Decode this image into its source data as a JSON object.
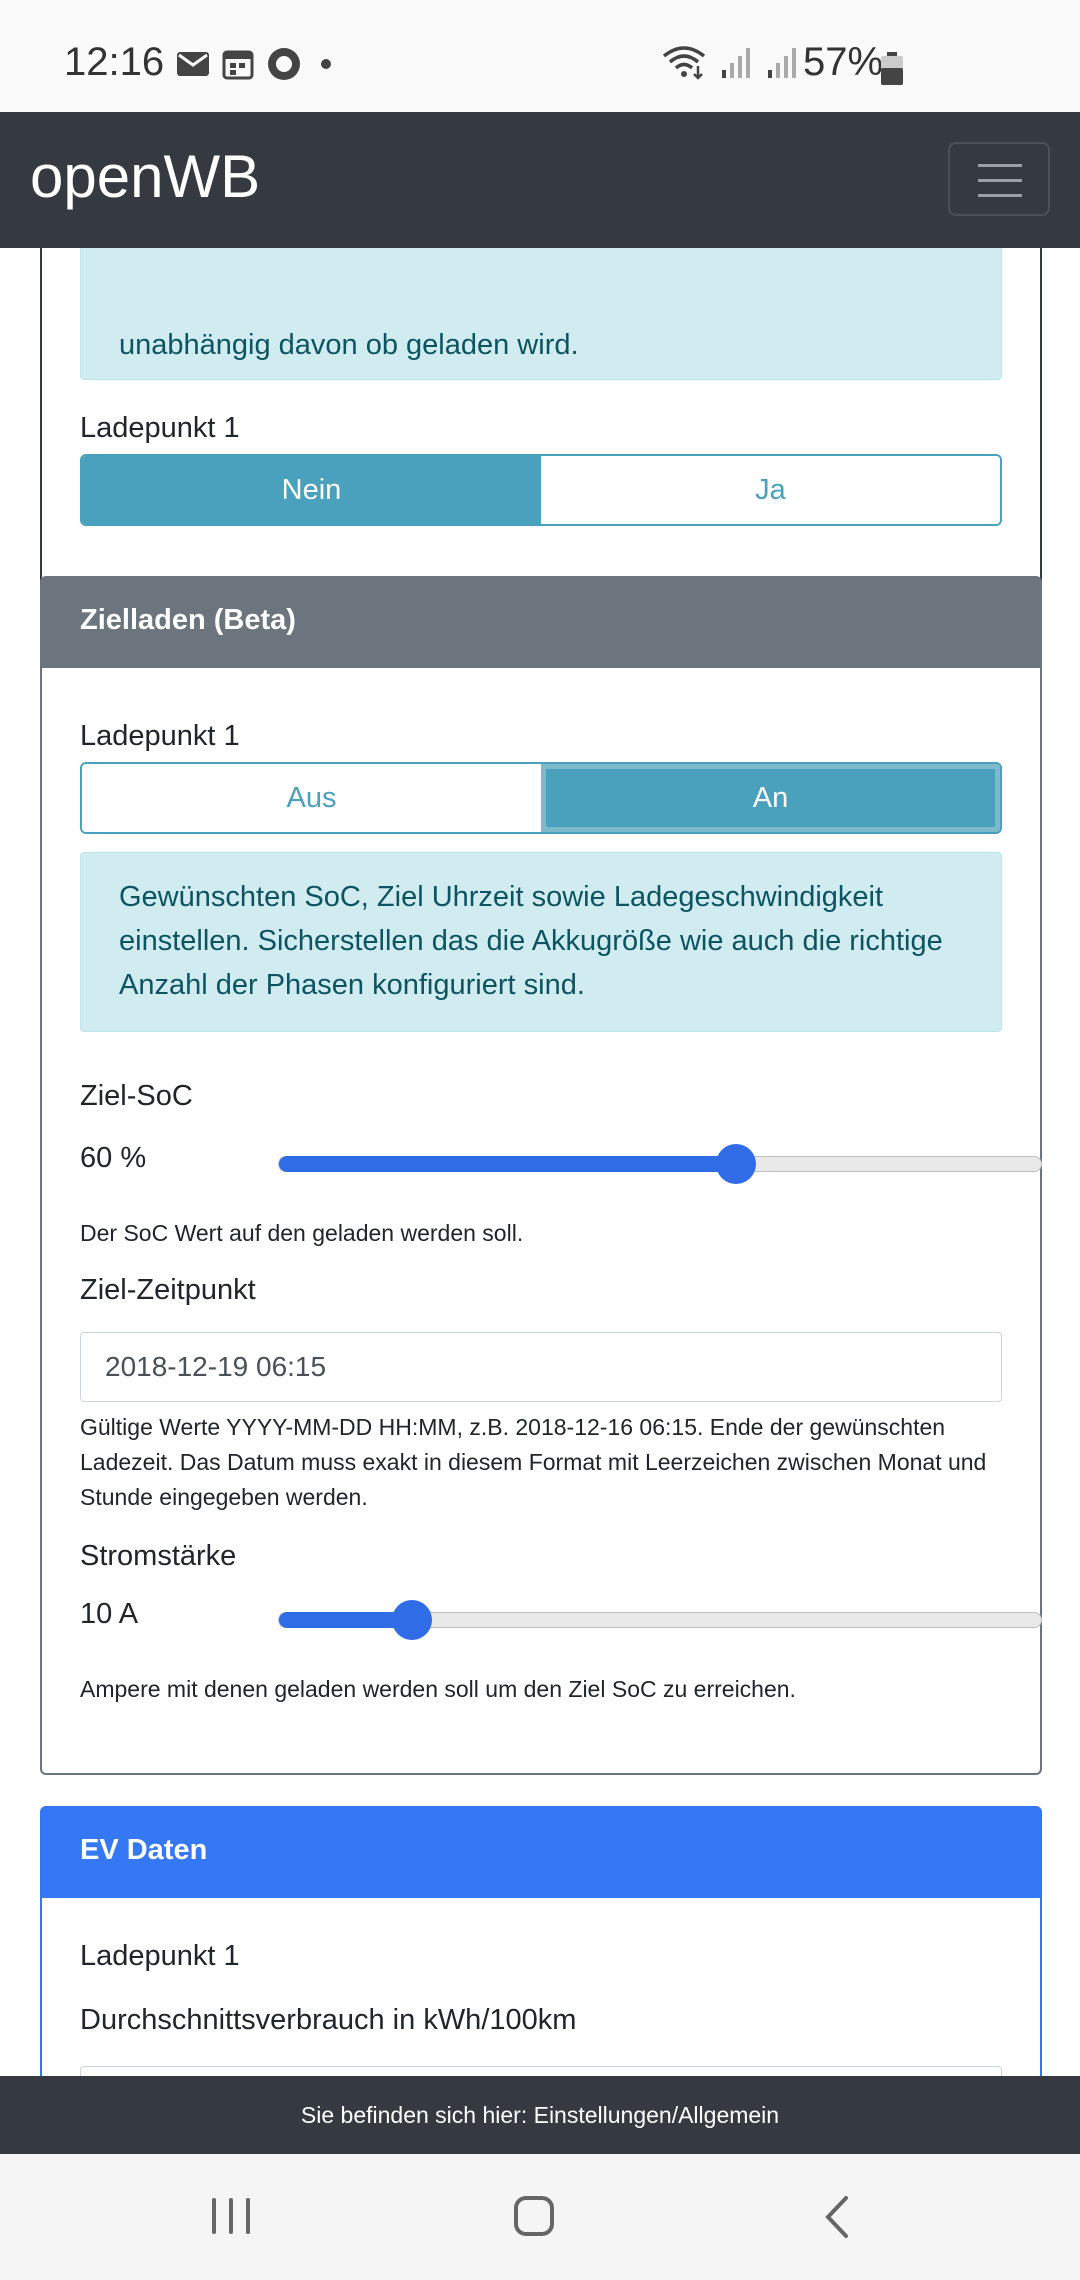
{
  "status_bar": {
    "time": "12:16",
    "battery": "57%",
    "icons": [
      "mail-icon",
      "calendar-icon",
      "record-icon",
      "dot-icon",
      "wifi-icon",
      "signal-icon",
      "signal-icon",
      "battery-icon"
    ]
  },
  "navbar": {
    "brand": "openWB",
    "menu_icon": "hamburger-menu-icon"
  },
  "card1": {
    "alert_text_partial": "unabhängig davon ob geladen wird.",
    "lp_label": "Ladepunkt 1",
    "btn_no": "Nein",
    "btn_yes": "Ja",
    "selected": "Nein"
  },
  "zielladen": {
    "header": "Zielladen (Beta)",
    "lp_label": "Ladepunkt 1",
    "btn_off": "Aus",
    "btn_on": "An",
    "selected": "An",
    "alert": "Gewünschten SoC, Ziel Uhrzeit sowie Ladegeschwindigkeit einstellen. Sicherstellen das die Akkugröße wie auch die richtige Anzahl der Phasen konfiguriert sind.",
    "soc_label": "Ziel-SoC",
    "soc_value": "60 %",
    "soc_fraction": 0.6,
    "soc_help": "Der SoC Wert auf den geladen werden soll.",
    "time_label": "Ziel-Zeitpunkt",
    "time_value": "2018-12-19 06:15",
    "time_help": "Gültige Werte YYYY-MM-DD HH:MM, z.B. 2018-12-16 06:15. Ende der gewünschten Ladezeit. Das Datum muss exakt in diesem Format mit Leerzeichen zwischen Monat und Stunde eingegeben werden.",
    "current_label": "Stromstärke",
    "current_value": "10 A",
    "current_fraction": 0.175,
    "current_help": "Ampere mit denen geladen werden soll um den Ziel SoC zu erreichen."
  },
  "ev_daten": {
    "header": "EV Daten",
    "lp_label": "Ladepunkt 1",
    "consumption_label": "Durchschnittsverbrauch in kWh/100km"
  },
  "footer": {
    "text": "Sie befinden sich hier: Einstellungen/Allgemein"
  },
  "android_nav": {
    "recent": "recent-apps-icon",
    "home": "home-icon",
    "back": "back-icon"
  }
}
